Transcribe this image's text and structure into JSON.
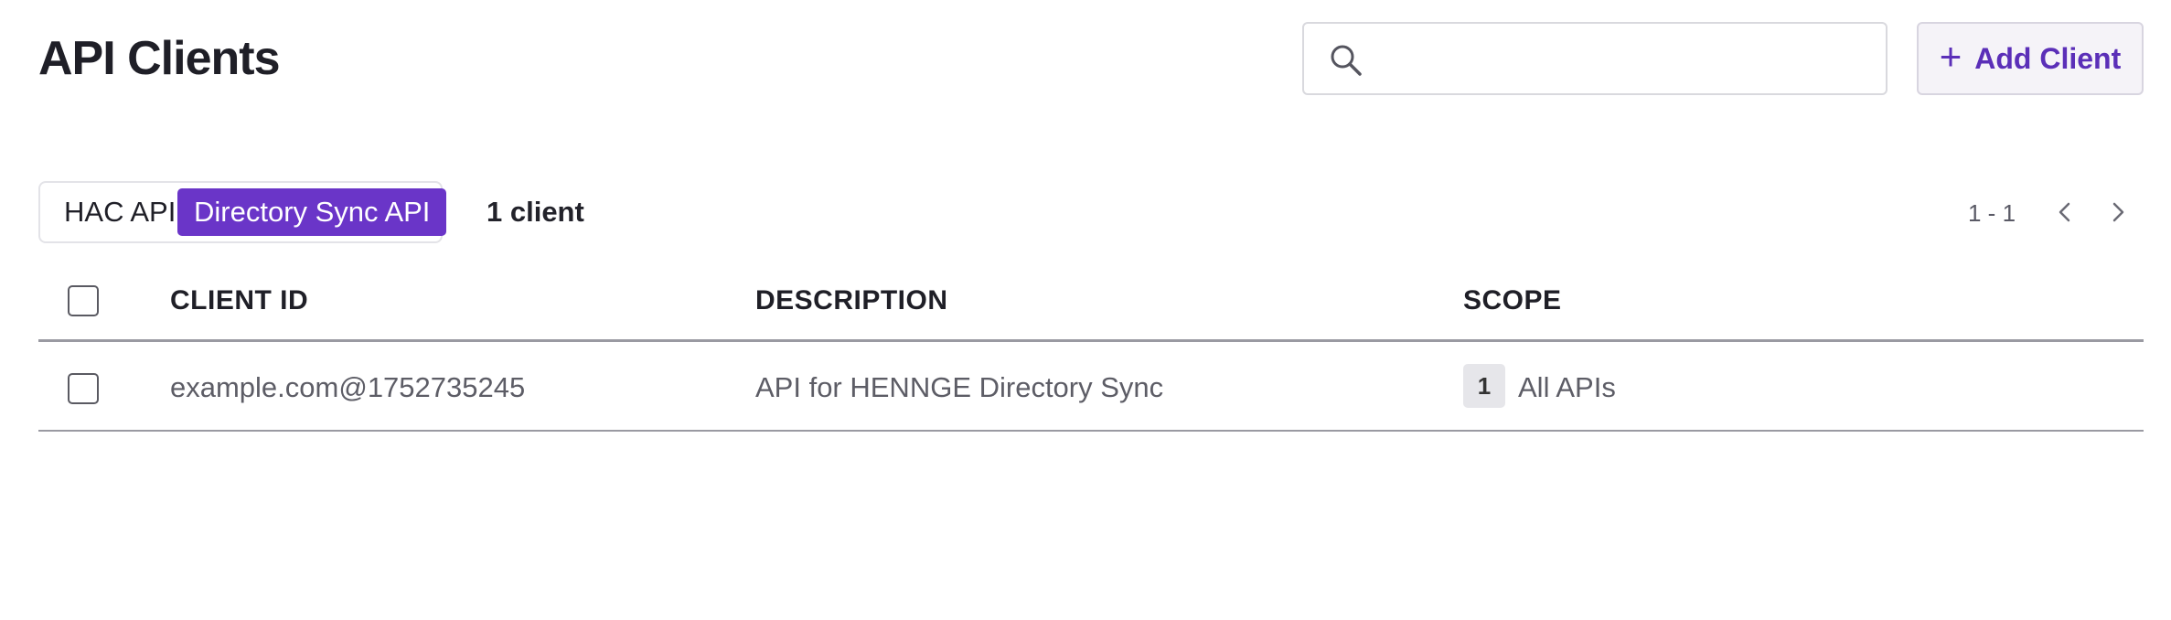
{
  "page": {
    "title": "API Clients"
  },
  "search": {
    "placeholder": "",
    "value": ""
  },
  "toolbar": {
    "add_label": "Add Client"
  },
  "tabs": [
    {
      "label": "HAC API",
      "active": false
    },
    {
      "label": "Directory Sync API",
      "active": true
    }
  ],
  "summary": {
    "count_text": "1 client"
  },
  "pagination": {
    "range": "1 - 1"
  },
  "table": {
    "columns": [
      "CLIENT ID",
      "DESCRIPTION",
      "SCOPE"
    ],
    "rows": [
      {
        "client_id": "example.com@1752735245",
        "description": "API for HENNGE Directory Sync",
        "scope_count": "1",
        "scope_label": "All APIs",
        "checked": false
      }
    ]
  },
  "colors": {
    "accent": "#6a35c8",
    "accent_text": "#5b2fb8",
    "text_primary": "#1f1f27",
    "text_secondary": "#5d5d66",
    "border": "#9a9aa2"
  },
  "icons": {
    "search": "search-icon",
    "add": "plus-icon",
    "prev": "chevron-left-icon",
    "next": "chevron-right-icon"
  }
}
